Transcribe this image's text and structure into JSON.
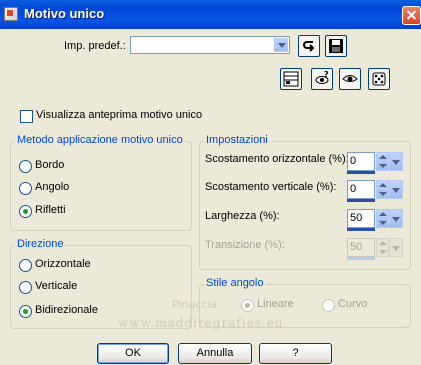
{
  "window": {
    "title": "Motivo unico"
  },
  "preset": {
    "label": "Imp. predef.:",
    "value": ""
  },
  "preview_checkbox": {
    "label": "Visualizza anteprima motivo unico",
    "checked": false
  },
  "metodo": {
    "title": "Metodo applicazione motivo unico",
    "options": [
      {
        "label": "Bordo",
        "selected": false
      },
      {
        "label": "Angolo",
        "selected": false
      },
      {
        "label": "Rifletti",
        "selected": true
      }
    ]
  },
  "direzione": {
    "title": "Direzione",
    "options": [
      {
        "label": "Orizzontale",
        "selected": false
      },
      {
        "label": "Verticale",
        "selected": false
      },
      {
        "label": "Bidirezionale",
        "selected": true
      }
    ]
  },
  "impostazioni": {
    "title": "Impostazioni",
    "fields": [
      {
        "label": "Scostamento orizzontale (%):",
        "value": "0",
        "enabled": true
      },
      {
        "label": "Scostamento verticale (%):",
        "value": "0",
        "enabled": true
      },
      {
        "label": "Larghezza (%):",
        "value": "50",
        "enabled": true
      },
      {
        "label": "Transizione (%):",
        "value": "50",
        "enabled": false
      }
    ]
  },
  "stile_angolo": {
    "title": "Stile angolo",
    "options": [
      {
        "label": "Lineare",
        "selected": true,
        "enabled": false
      },
      {
        "label": "Curvo",
        "selected": false,
        "enabled": false
      }
    ]
  },
  "buttons": {
    "ok": "OK",
    "cancel": "Annulla",
    "help": "?"
  },
  "watermark": {
    "line1": "Pinuccia",
    "line2": "www.maddiregrafies.eu"
  },
  "colors": {
    "titlebar": "#0046d5",
    "accent": "#0046d5",
    "radio_dot": "#21a121",
    "background": "#ece9d8"
  }
}
